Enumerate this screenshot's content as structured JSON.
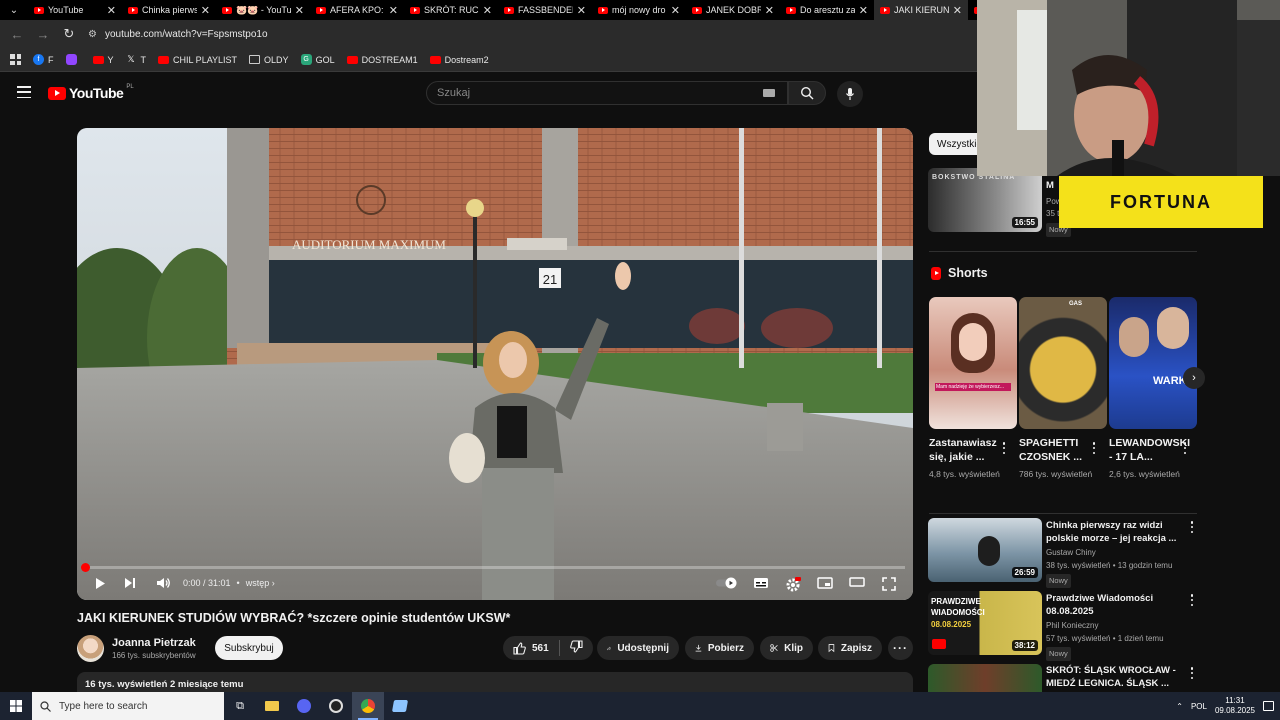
{
  "browser": {
    "tabs": [
      {
        "title": "YouTube",
        "active": false
      },
      {
        "title": "Chinka pierwsz",
        "active": false
      },
      {
        "title": "🐷🐷 - YouTu",
        "active": false
      },
      {
        "title": "AFERA KPO:",
        "active": false
      },
      {
        "title": "SKRÓT: RUCH",
        "active": false
      },
      {
        "title": "FASSBENDER",
        "active": false
      },
      {
        "title": "mój nowy dro",
        "active": false
      },
      {
        "title": "JANEK DOBR",
        "active": false
      },
      {
        "title": "Do aresztu za",
        "active": false
      },
      {
        "title": "JAKI KIERUNE",
        "active": true
      },
      {
        "title": "W",
        "active": false
      }
    ],
    "url": "youtube.com/watch?v=Fspsmstpo1o",
    "bookmarks": [
      {
        "label": "F",
        "icon": "facebook-icon"
      },
      {
        "label": "",
        "icon": "twitch-icon"
      },
      {
        "label": "Y",
        "icon": "youtube-icon"
      },
      {
        "label": "T",
        "icon": "x-icon"
      },
      {
        "label": "CHIL PLAYLIST",
        "icon": "youtube-icon"
      },
      {
        "label": "OLDY",
        "icon": "folder-icon"
      },
      {
        "label": "GOL",
        "icon": "gol-icon"
      },
      {
        "label": "DOSTREAM1",
        "icon": "youtube-icon"
      },
      {
        "label": "Dostream2",
        "icon": "youtube-icon"
      }
    ]
  },
  "youtube": {
    "logo_text": "YouTube",
    "logo_country": "PL",
    "search_placeholder": "Szukaj"
  },
  "video": {
    "time": "0:00 / 31:01",
    "chapter": "wstęp",
    "title": "JAKI KIERUNEK STUDIÓW WYBRAĆ? *szczere opinie studentów UKSW*",
    "channel": "Joanna Pietrzak",
    "subscribers": "166 tys. subskrybentów",
    "subscribe_label": "Subskrybuj",
    "likes": "561",
    "share_label": "Udostępnij",
    "download_label": "Pobierz",
    "clip_label": "Klip",
    "save_label": "Zapisz",
    "description": "16 tys. wyświetleń  2 miesiące temu",
    "progress": 0,
    "scene_text": {
      "building": "AUDITORIUM MAXIMUM",
      "number": "21"
    }
  },
  "sidebar": {
    "chip": "Wszystkie",
    "top_video": {
      "duration": "16:55",
      "title_fragment": "M",
      "meta1": "Pow",
      "meta2": "35 t",
      "badge": "Nowy",
      "thumb_text": "BOKSTWO STALINA"
    },
    "shorts_heading": "Shorts",
    "shorts": [
      {
        "title": "Zastanawiasz się, jakie ...",
        "views": "4,8 tys. wyświetleń"
      },
      {
        "title": "SPAGHETTI CZOSNEK ...",
        "views": "786 tys. wyświetleń"
      },
      {
        "title": "LEWANDOWSKI - 17 LA...",
        "views": "2,6 tys. wyświetleń"
      }
    ],
    "videos": [
      {
        "title": "Chinka pierwszy raz widzi polskie morze – jej reakcja ...",
        "channel": "Gustaw Chiny",
        "meta": "38 tys. wyświetleń • 13 godzin temu",
        "badge": "Nowy",
        "duration": "26:59"
      },
      {
        "title": "Prawdziwe Wiadomości 08.08.2025",
        "channel": "Phil Konieczny",
        "meta": "57 tys. wyświetleń • 1 dzień temu",
        "badge": "Nowy",
        "duration": "38:12",
        "thumb_text1": "PRAWDZIWE",
        "thumb_text2": "WIADOMOŚCI",
        "thumb_text3": "08.08.2025"
      },
      {
        "title": "SKRÓT: ŚLĄSK WROCŁAW - MIEDŹ LEGNICA. ŚLĄSK ...",
        "channel": "",
        "meta": "",
        "badge": "",
        "duration": ""
      }
    ],
    "shorts_thumb_text": "Mam nadzieję że wybierzesz...",
    "shorts_thumb_gas": "GAS",
    "shorts_thumb_wark": "WARK"
  },
  "overlay": {
    "sponsor": "FORTUNA"
  },
  "taskbar": {
    "search_placeholder": "Type here to search",
    "language": "POL",
    "time": "11:31",
    "date": "09.08.2025"
  }
}
